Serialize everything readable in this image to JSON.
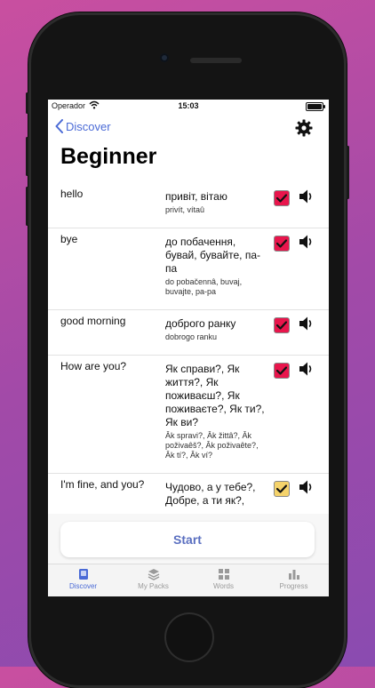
{
  "status_bar": {
    "carrier": "Operador",
    "time": "15:03"
  },
  "nav": {
    "back_label": "Discover"
  },
  "page": {
    "title": "Beginner"
  },
  "colors": {
    "accent": "#4a6ad6",
    "checked": "#e8154c",
    "pending": "#f5d36b"
  },
  "entries": [
    {
      "word": "hello",
      "translation": "привіт, вітаю",
      "transliteration": "privít, vítaû",
      "state": "checked"
    },
    {
      "word": "bye",
      "translation": "до побачення, бувай, бувайте, па-па",
      "transliteration": "do pobačennâ, buvaj, buvajte, pa-pa",
      "state": "checked"
    },
    {
      "word": "good morning",
      "translation": "доброго ранку",
      "transliteration": "dobrogo ranku",
      "state": "checked"
    },
    {
      "word": "How are you?",
      "translation": "Як справи?, Як життя?, Як поживаєш?, Як поживаєте?, Як ти?, Як ви?",
      "transliteration": "Âk spravi?, Âk žittâ?, Âk poživaêš?, Âk poživaête?, Âk tí?, Âk ví?",
      "state": "checked"
    },
    {
      "word": "I'm fine, and you?",
      "translation": "Чудово, а у тебе?, Добре, а ти як?,",
      "transliteration": "",
      "state": "pending"
    }
  ],
  "actions": {
    "start_label": "Start"
  },
  "tabs": [
    {
      "label": "Discover",
      "icon": "discover-icon",
      "active": true
    },
    {
      "label": "My Packs",
      "icon": "packs-icon",
      "active": false
    },
    {
      "label": "Words",
      "icon": "words-icon",
      "active": false
    },
    {
      "label": "Progress",
      "icon": "progress-icon",
      "active": false
    }
  ]
}
